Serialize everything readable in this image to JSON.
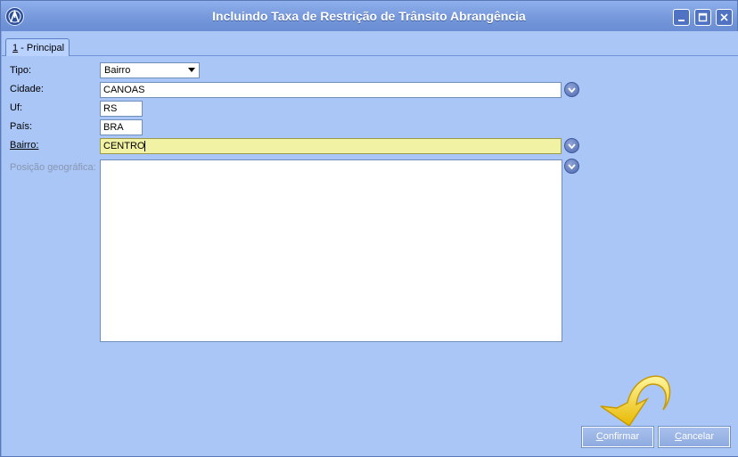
{
  "window": {
    "title": "Incluindo Taxa de Restrição de Trânsito Abrangência",
    "icons": [
      "app-logo-icon",
      "minimize-icon",
      "maximize-icon",
      "close-icon"
    ]
  },
  "tabs": [
    {
      "hotkey": "1",
      "label": " - Principal"
    }
  ],
  "form": {
    "tipo": {
      "label": "Tipo:",
      "value": "Bairro"
    },
    "cidade": {
      "label": "Cidade:",
      "value": "CANOAS"
    },
    "uf": {
      "label": "Uf:",
      "value": "RS"
    },
    "pais": {
      "label": "País:",
      "value": "BRA"
    },
    "bairro": {
      "label": "Bairro:",
      "value": "CENTRO"
    },
    "posicao": {
      "label": "Posição geográfica:",
      "value": ""
    }
  },
  "buttons": {
    "confirm": {
      "hotkey": "C",
      "rest": "onfirmar"
    },
    "cancel": {
      "hotkey": "C",
      "rest": "ancelar"
    }
  },
  "colors": {
    "panel": "#a9c6f6",
    "active_field": "#f2f2a4",
    "accent_arrow": "#f3d21c"
  }
}
